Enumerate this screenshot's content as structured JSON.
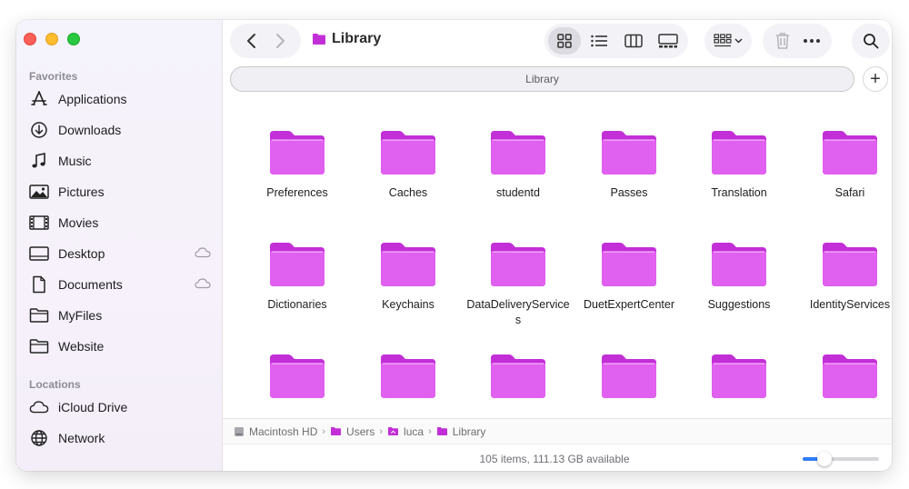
{
  "window": {
    "title": "Library"
  },
  "sidebar": {
    "favorites_title": "Favorites",
    "favorites": [
      {
        "label": "Applications",
        "icon": "applications-icon"
      },
      {
        "label": "Downloads",
        "icon": "downloads-icon"
      },
      {
        "label": "Music",
        "icon": "music-icon"
      },
      {
        "label": "Pictures",
        "icon": "pictures-icon"
      },
      {
        "label": "Movies",
        "icon": "movies-icon"
      },
      {
        "label": "Desktop",
        "icon": "desktop-icon",
        "cloud": true
      },
      {
        "label": "Documents",
        "icon": "documents-icon",
        "cloud": true
      },
      {
        "label": "MyFiles",
        "icon": "folder-icon"
      },
      {
        "label": "Website",
        "icon": "folder-icon"
      }
    ],
    "locations_title": "Locations",
    "locations": [
      {
        "label": "iCloud Drive",
        "icon": "icloud-icon"
      },
      {
        "label": "Network",
        "icon": "network-icon"
      }
    ]
  },
  "tab": {
    "label": "Library"
  },
  "folders": [
    "Preferences",
    "Caches",
    "studentd",
    "Passes",
    "Translation",
    "Safari",
    "Dictionaries",
    "Keychains",
    "DataDeliveryServices",
    "DuetExpertCenter",
    "Suggestions",
    "IdentityServices",
    "",
    "",
    "",
    "",
    "",
    ""
  ],
  "path": [
    {
      "label": "Macintosh HD",
      "icon": "disk-icon"
    },
    {
      "label": "Users",
      "icon": "folder-icon"
    },
    {
      "label": "luca",
      "icon": "home-icon"
    },
    {
      "label": "Library",
      "icon": "folder-icon"
    }
  ],
  "status": {
    "text": "105 items, 111.13 GB available",
    "zoom_level": 0.28
  },
  "colors": {
    "folder": "#c22fd6",
    "folder_light": "#e060ef",
    "accent": "#2f7df6"
  }
}
